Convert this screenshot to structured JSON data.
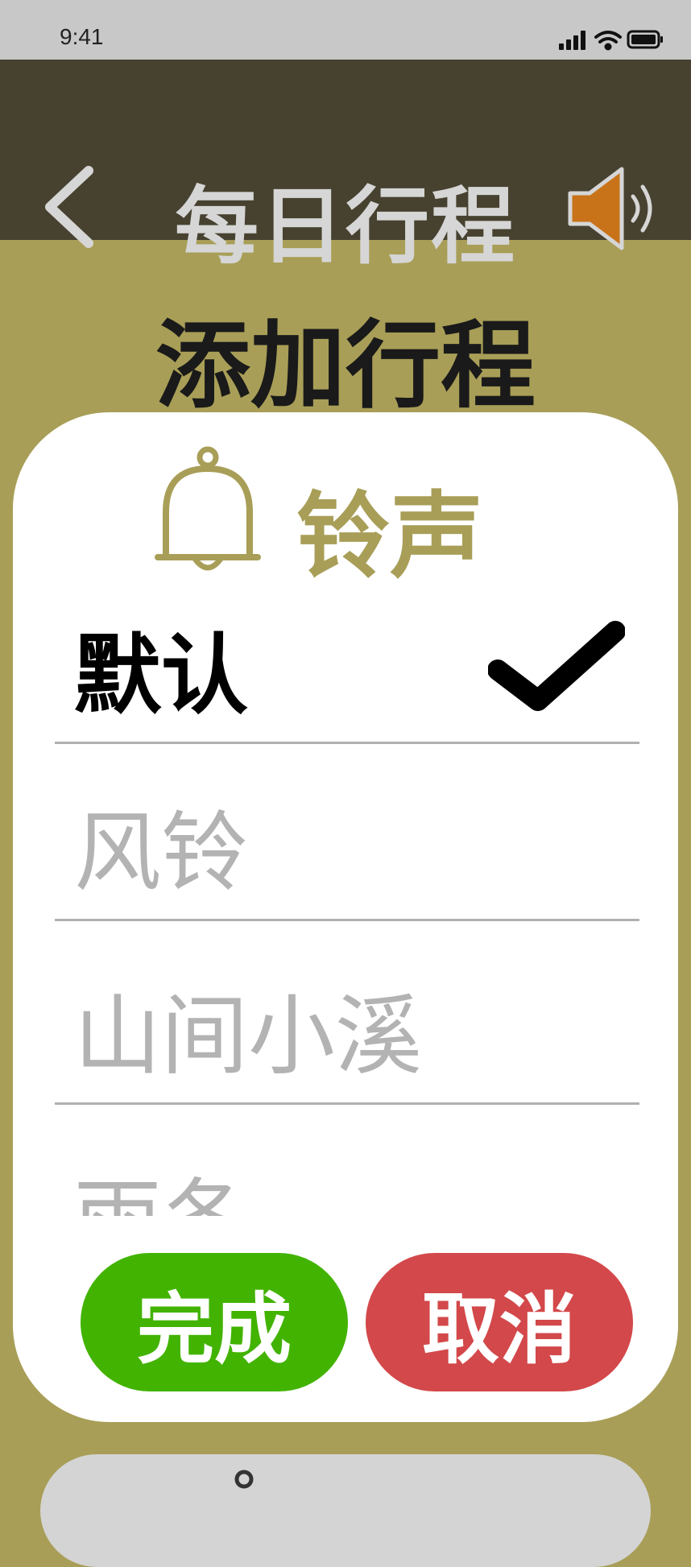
{
  "status_bar": {
    "time": "9:41",
    "icons": [
      "signal-icon",
      "wifi-icon",
      "battery-icon"
    ]
  },
  "nav": {
    "back_icon": "chevron-left-icon",
    "title": "每日行程",
    "speaker_icon": "speaker-icon"
  },
  "section_title": "添加行程",
  "sheet": {
    "icon": "bell-icon",
    "title": "铃声",
    "options": [
      {
        "label": "默认",
        "selected": true
      },
      {
        "label": "风铃",
        "selected": false
      },
      {
        "label": "山间小溪",
        "selected": false
      },
      {
        "label": "雨冬",
        "selected": false
      }
    ],
    "selected_icon": "checkmark-icon"
  },
  "buttons": {
    "done": "完成",
    "cancel": "取消"
  },
  "colors": {
    "background": "#a89e57",
    "nav_bar": "#474230",
    "accent": "#a89e57",
    "speaker": "#c8731a",
    "done": "#42b300",
    "cancel": "#d3484a",
    "unselected_text": "#b3b3b3"
  }
}
